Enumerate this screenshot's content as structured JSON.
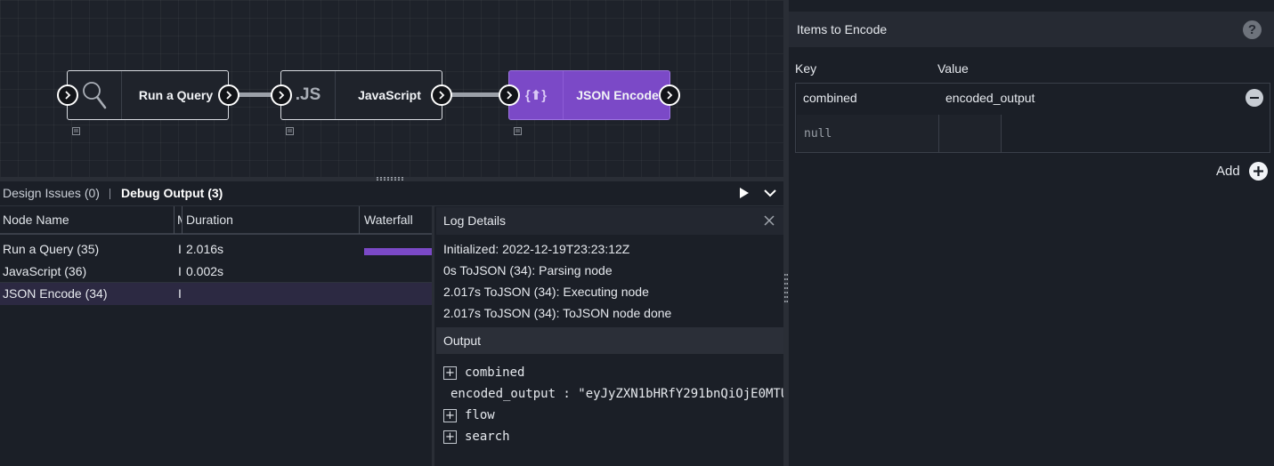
{
  "canvas": {
    "nodes": [
      {
        "label": "Run a Query",
        "icon": "search-icon",
        "selected": false
      },
      {
        "label": "JavaScript",
        "icon": "js-icon",
        "icon_text": ".JS",
        "selected": false
      },
      {
        "label": "JSON Encode",
        "icon": "json-encode-icon",
        "icon_text": "{⬆}",
        "selected": true
      }
    ]
  },
  "tabs": {
    "design_issues": "Design Issues (0)",
    "debug_output": "Debug Output (3)"
  },
  "debug_table": {
    "columns": [
      "Node Name",
      "M",
      "Duration",
      "Waterfall"
    ],
    "rows": [
      {
        "name": "Run a Query (35)",
        "m": "I",
        "duration": "2.016s",
        "waterfall_fraction": 1.0
      },
      {
        "name": "JavaScript (36)",
        "m": "I",
        "duration": "0.002s"
      },
      {
        "name": "JSON Encode (34)",
        "m": "I",
        "duration": ""
      }
    ]
  },
  "log_details": {
    "title": "Log Details",
    "lines": [
      "Initialized: 2022-12-19T23:23:12Z",
      "0s ToJSON (34): Parsing node",
      "2.017s ToJSON (34): Executing node",
      "2.017s ToJSON (34): ToJSON node done"
    ],
    "output_title": "Output",
    "output_tree": [
      {
        "key": "combined",
        "expandable": true
      },
      {
        "key": "encoded_output",
        "value": "encoded_output : \"eyJyZXN1bHRfY291bnQiOjE0MTU",
        "expandable": false
      },
      {
        "key": "flow",
        "expandable": true
      },
      {
        "key": "search",
        "expandable": true
      }
    ]
  },
  "right_panel": {
    "title": "Items to Encode",
    "help": "?",
    "key_header": "Key",
    "value_header": "Value",
    "rows": [
      {
        "key": "combined",
        "value": "encoded_output"
      }
    ],
    "new_key_placeholder": "null",
    "add_label": "Add"
  },
  "colors": {
    "accent": "#7b49c7",
    "background": "#1b1f27"
  }
}
